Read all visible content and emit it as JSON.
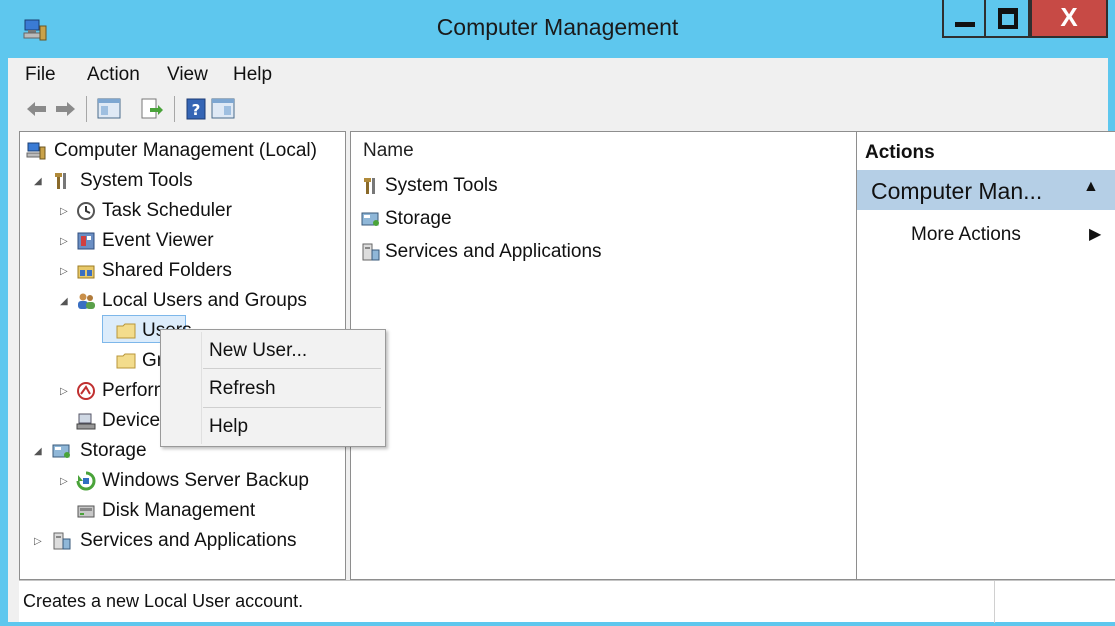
{
  "window": {
    "title": "Computer Management",
    "close_glyph": "X"
  },
  "menubar": [
    "File",
    "Action",
    "View",
    "Help"
  ],
  "toolbar": {
    "icons": [
      "back-arrow-icon",
      "forward-arrow-icon",
      "show-hide-console-tree-icon",
      "export-list-icon",
      "help-icon",
      "show-hide-action-pane-icon"
    ]
  },
  "tree": {
    "root": "Computer Management (Local)",
    "system_tools": "System Tools",
    "task_scheduler": "Task Scheduler",
    "event_viewer": "Event Viewer",
    "shared_folders": "Shared Folders",
    "local_users_groups": "Local Users and Groups",
    "users": "Users",
    "groups": "Groups",
    "performance": "Performance",
    "device_manager": "Device Manager",
    "storage": "Storage",
    "windows_server_backup": "Windows Server Backup",
    "disk_management": "Disk Management",
    "services_apps": "Services and Applications"
  },
  "center": {
    "column_header": "Name",
    "items": [
      "System Tools",
      "Storage",
      "Services and Applications"
    ]
  },
  "actions": {
    "title": "Actions",
    "section": "Computer Man...",
    "more": "More Actions"
  },
  "context_menu": {
    "new_user": "New User...",
    "refresh": "Refresh",
    "help": "Help"
  },
  "status": {
    "text": "Creates a new Local User account."
  },
  "colors": {
    "title_bar": "#5ec7ee",
    "close_button": "#c74a45",
    "actions_header": "#b5cfe6",
    "selection": "#dcecfb"
  }
}
